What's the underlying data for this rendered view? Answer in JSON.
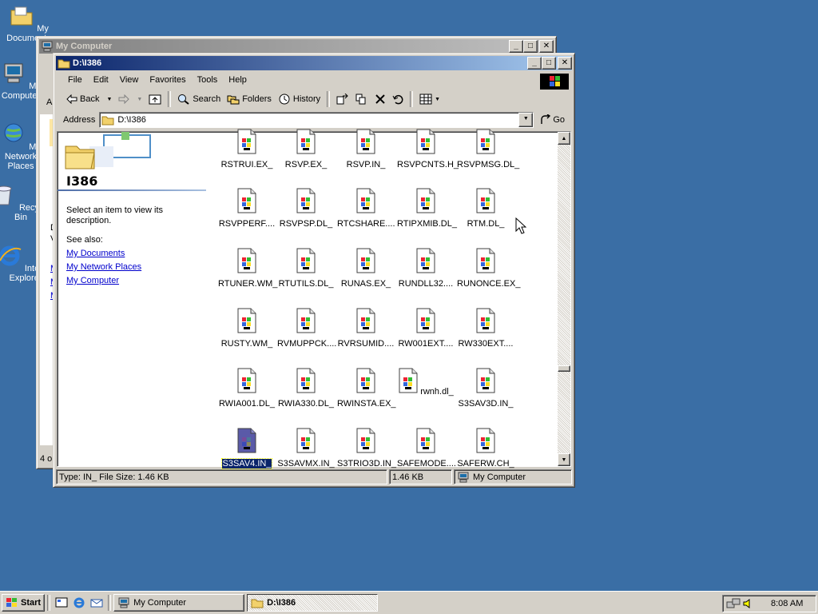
{
  "desktop": {
    "icons": [
      {
        "label": "My Documents"
      },
      {
        "label": "My Computer"
      },
      {
        "label": "My Network Places"
      },
      {
        "label": "Recycle Bin"
      },
      {
        "label": "Internet Explorer"
      }
    ]
  },
  "back_window": {
    "title": "My Computer",
    "status_left": "4 ol",
    "left_text_fragment": [
      "D",
      "V"
    ],
    "left_link_fragments": [
      "M",
      "M",
      "M"
    ],
    "toolbar_fragment": "A"
  },
  "main_window": {
    "title": "D:\\I386",
    "menu": [
      "File",
      "Edit",
      "View",
      "Favorites",
      "Tools",
      "Help"
    ],
    "toolbar": {
      "back": "Back",
      "search": "Search",
      "folders": "Folders",
      "history": "History"
    },
    "address": {
      "label": "Address",
      "value": "D:\\I386",
      "go": "Go"
    },
    "left_pane": {
      "folder_name": "I386",
      "description": "Select an item to view its description.",
      "see_also": "See also:",
      "links": [
        "My Documents",
        "My Network Places",
        "My Computer"
      ]
    },
    "files": [
      [
        "RSTRUI.EX_",
        "RSVP.EX_",
        "RSVP.IN_",
        "RSVPCNTS.H_",
        "RSVPMSG.DL_"
      ],
      [
        "RSVPPERF....",
        "RSVPSP.DL_",
        "RTCSHARE....",
        "RTIPXMIB.DL_",
        "RTM.DL_"
      ],
      [
        "RTUNER.WM_",
        "RTUTILS.DL_",
        "RUNAS.EX_",
        "RUNDLL32....",
        "RUNONCE.EX_"
      ],
      [
        "RUSTY.WM_",
        "RVMUPPCK....",
        "RVRSUMID....",
        "RW001EXT....",
        "RW330EXT...."
      ],
      [
        "RWIA001.DL_",
        "RWIA330.DL_",
        "RWINSTA.EX_",
        "rwnh.dl_",
        "S3SAV3D.IN_"
      ],
      [
        "S3SAV4.IN_",
        "S3SAVMX.IN_",
        "S3TRIO3D.IN_",
        "SAFEMODE....",
        "SAFERW.CH_"
      ]
    ],
    "selected_file": "S3SAV4.IN_",
    "status": {
      "info": "Type: IN_ File Size: 1.46 KB",
      "size": "1.46 KB",
      "zone": "My Computer"
    }
  },
  "taskbar": {
    "start": "Start",
    "tasks": [
      {
        "label": "My Computer",
        "active": false
      },
      {
        "label": "D:\\I386",
        "active": true
      }
    ],
    "clock": "8:08 AM"
  }
}
